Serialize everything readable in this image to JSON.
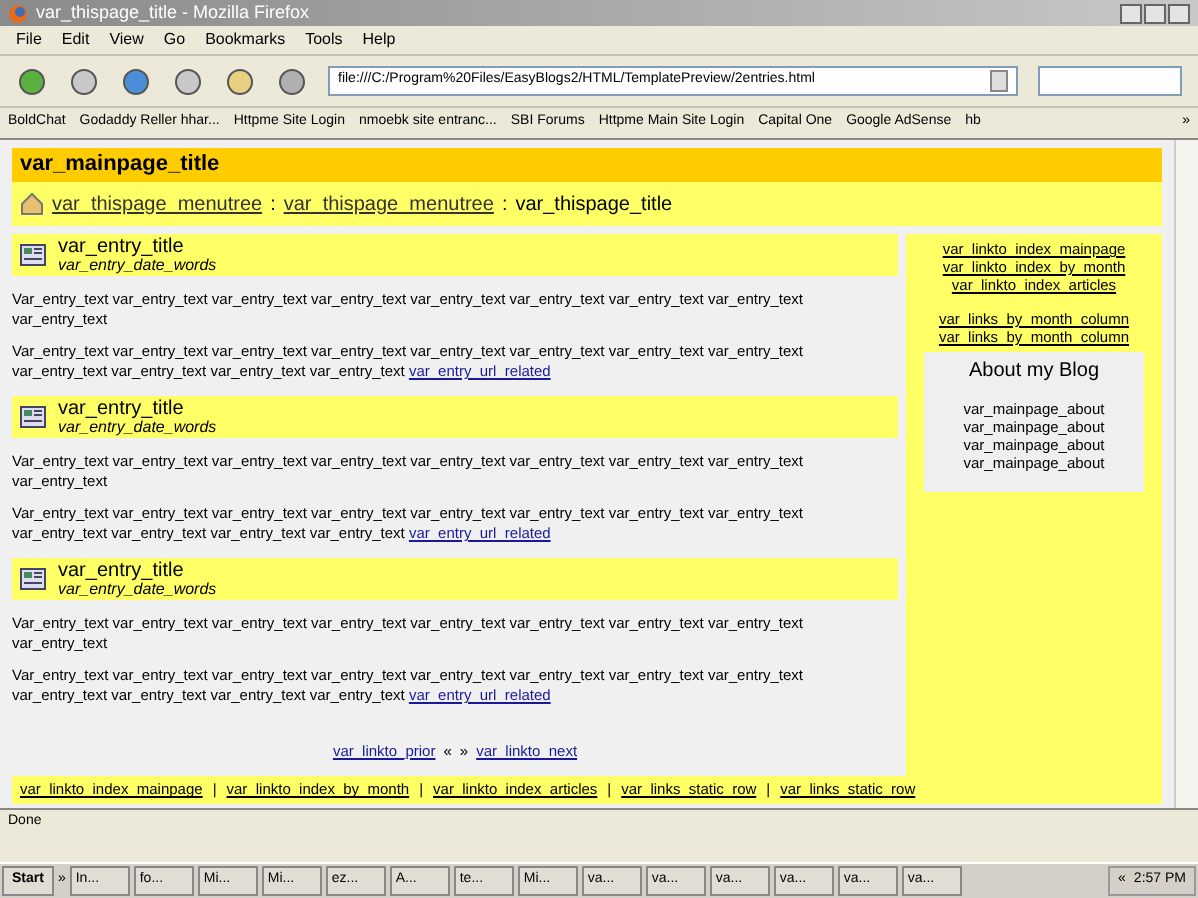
{
  "window": {
    "title": "var_thispage_title - Mozilla Firefox"
  },
  "menu": [
    "File",
    "Edit",
    "View",
    "Go",
    "Bookmarks",
    "Tools",
    "Help"
  ],
  "address": {
    "value": "file:///C:/Program%20Files/EasyBlogs2/HTML/TemplatePreview/2entries.html"
  },
  "bookmarks": [
    "BoldChat",
    "Godaddy Reller hhar...",
    "Httpme Site Login",
    "nmoebk site entranc...",
    "SBI Forums",
    "Httpme Main Site Login",
    "Capital One",
    "Google AdSense",
    "hb"
  ],
  "bookmarks_more": "»",
  "page": {
    "title": "var_mainpage_title",
    "breadcrumb": {
      "links": [
        "var_thispage_menutree",
        "var_thispage_menutree"
      ],
      "separator": ":",
      "current": "var_thispage_title"
    },
    "entries": [
      {
        "title": "var_entry_title",
        "date": "var_entry_date_words",
        "paragraphs": [
          "Var_entry_text var_entry_text var_entry_text var_entry_text var_entry_text var_entry_text var_entry_text var_entry_text var_entry_text",
          "Var_entry_text var_entry_text var_entry_text var_entry_text var_entry_text var_entry_text var_entry_text var_entry_text var_entry_text var_entry_text var_entry_text var_entry_text"
        ],
        "link": "var_entry_url_related"
      },
      {
        "title": "var_entry_title",
        "date": "var_entry_date_words",
        "paragraphs": [
          "Var_entry_text var_entry_text var_entry_text var_entry_text var_entry_text var_entry_text var_entry_text var_entry_text var_entry_text",
          "Var_entry_text var_entry_text var_entry_text var_entry_text var_entry_text var_entry_text var_entry_text var_entry_text var_entry_text var_entry_text var_entry_text var_entry_text"
        ],
        "link": "var_entry_url_related"
      },
      {
        "title": "var_entry_title",
        "date": "var_entry_date_words",
        "paragraphs": [
          "Var_entry_text var_entry_text var_entry_text var_entry_text var_entry_text var_entry_text var_entry_text var_entry_text var_entry_text",
          "Var_entry_text var_entry_text var_entry_text var_entry_text var_entry_text var_entry_text var_entry_text var_entry_text var_entry_text var_entry_text var_entry_text var_entry_text"
        ],
        "link": "var_entry_url_related"
      }
    ],
    "pager": {
      "prior": "var_linkto_prior",
      "prior_mark": "«",
      "next_mark": "»",
      "next": "var_linkto_next"
    },
    "sidebar": {
      "index_links": [
        "var_linkto_index_mainpage",
        "var_linkto_index_by_month",
        "var_linkto_index_articles"
      ],
      "month_links": [
        "var_links_by_month_column",
        "var_links_by_month_column"
      ],
      "about": {
        "title": "About my Blog",
        "lines": [
          "var_mainpage_about",
          "var_mainpage_about",
          "var_mainpage_about",
          "var_mainpage_about"
        ]
      }
    },
    "footer_links": [
      "var_linkto_index_mainpage",
      "var_linkto_index_by_month",
      "var_linkto_index_articles",
      "var_links_static_row",
      "var_links_static_row"
    ],
    "footer_separator": "|"
  },
  "status_bar": "Done",
  "taskbar": {
    "start": "Start",
    "overflow": "»",
    "tasks": [
      "In...",
      "fo...",
      "Mi...",
      "Mi...",
      "ez...",
      "A...",
      "te...",
      "Mi...",
      "va...",
      "va...",
      "va...",
      "va...",
      "va...",
      "va..."
    ],
    "tray_toggle": "«",
    "time": "2:57 PM"
  }
}
